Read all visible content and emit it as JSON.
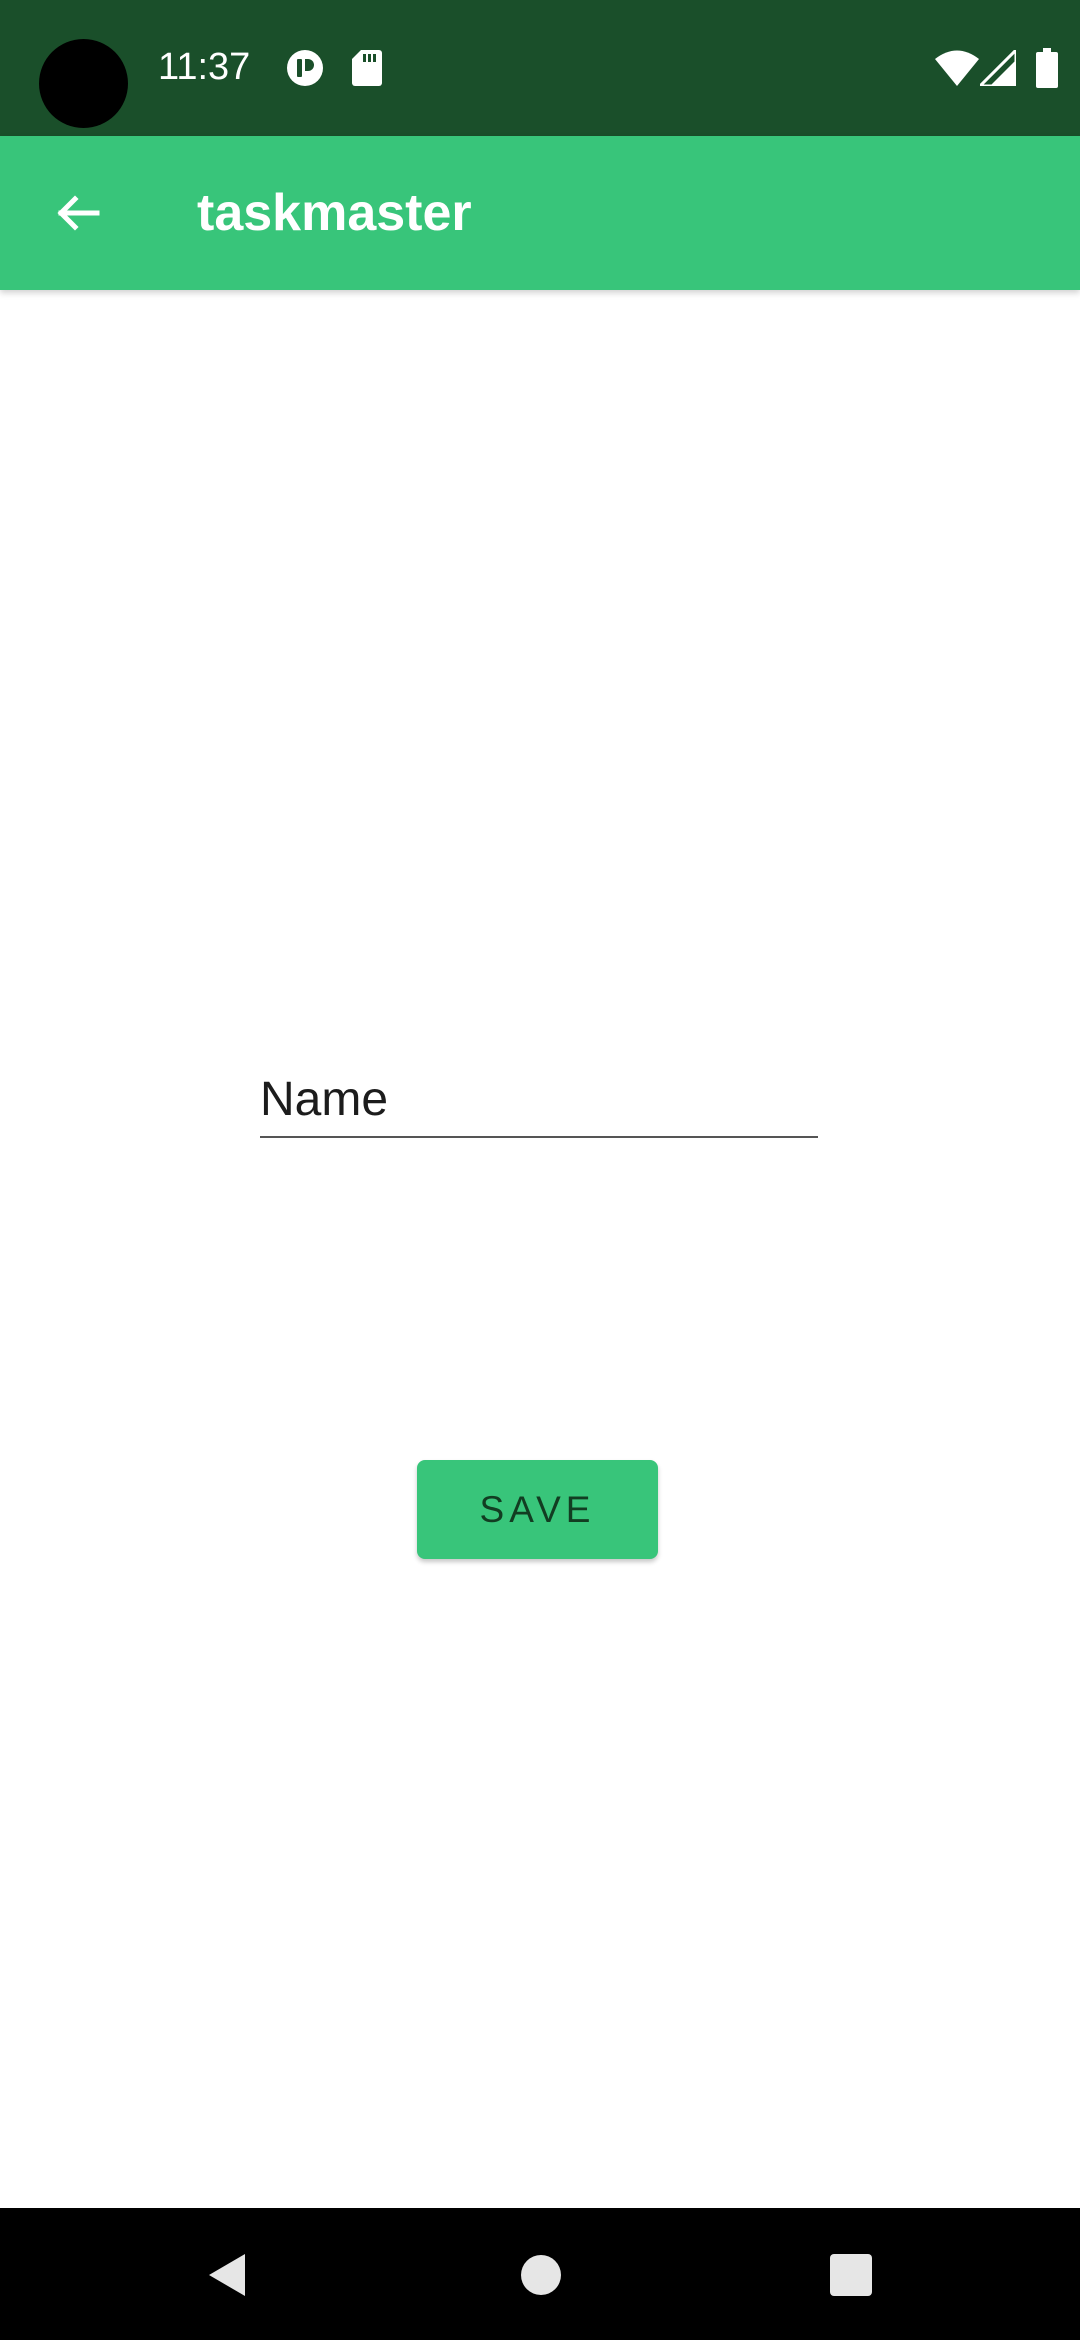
{
  "status_bar": {
    "time": "11:37",
    "icons": [
      "app-status-icon",
      "sd-card-icon",
      "wifi-icon",
      "cell-signal-icon",
      "battery-icon"
    ]
  },
  "app_bar": {
    "title": "taskmaster",
    "back_icon": "arrow-back-icon"
  },
  "form": {
    "name_placeholder": "Name",
    "name_value": "",
    "save_label": "SAVE"
  },
  "nav_bar": {
    "icons": [
      "nav-back-icon",
      "nav-home-icon",
      "nav-recents-icon"
    ]
  },
  "colors": {
    "status_bar": "#1a4f2a",
    "primary": "#38c57a",
    "button_text": "#123d22",
    "nav_bar": "#000000"
  }
}
